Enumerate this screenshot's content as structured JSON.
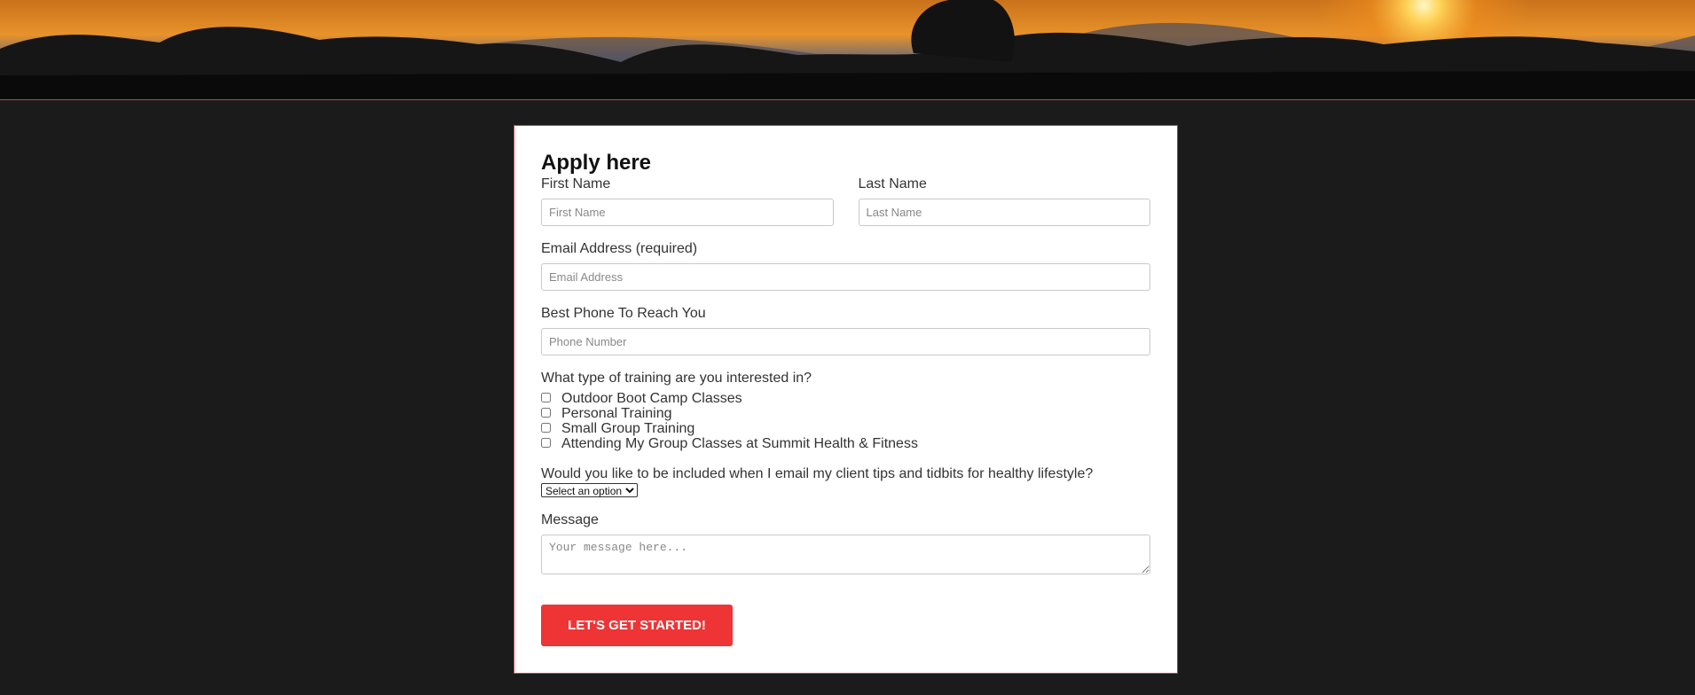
{
  "hero": {
    "image_name": "mountain-sunset-banner"
  },
  "form": {
    "title": "Apply here",
    "first_name": {
      "label": "First Name",
      "placeholder": "First Name"
    },
    "last_name": {
      "label": "Last Name",
      "placeholder": "Last Name"
    },
    "email": {
      "label": "Email Address (required)",
      "placeholder": "Email Address"
    },
    "phone": {
      "label": "Best Phone To Reach You",
      "placeholder": "Phone Number"
    },
    "training": {
      "question": "What type of training are you interested in?",
      "options": [
        "Outdoor Boot Camp Classes",
        "Personal Training",
        "Small Group Training",
        "Attending My Group Classes at Summit Health & Fitness"
      ]
    },
    "newsletter": {
      "question": "Would you like to be included when I email my client tips and tidbits for healthy lifestyle?",
      "selected": "Select an option"
    },
    "message": {
      "label": "Message",
      "placeholder": "Your message here..."
    },
    "submit_label": "LET'S GET STARTED!"
  },
  "colors": {
    "accent": "#ef3436",
    "page_background": "#1b1b1b",
    "border_accent": "#d33b3b"
  }
}
